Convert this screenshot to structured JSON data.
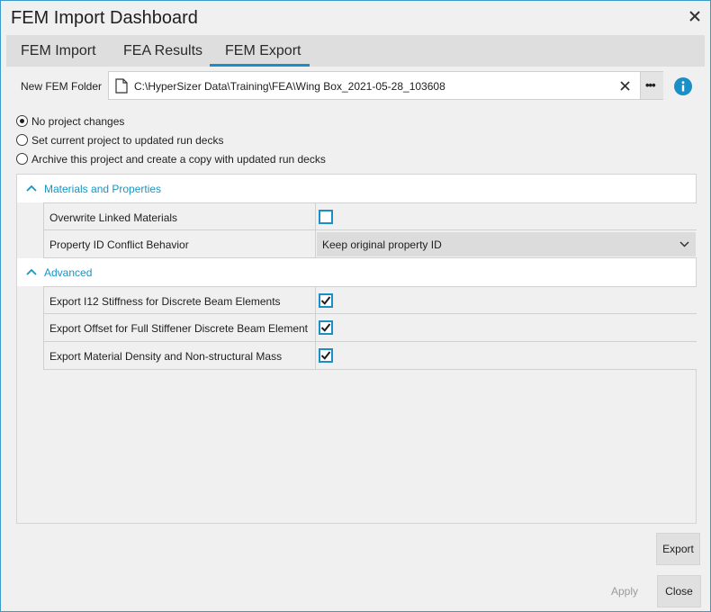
{
  "window": {
    "title": "FEM Import Dashboard",
    "accent_color": "#1a8ec7",
    "close_icon": "close-icon"
  },
  "tabs": [
    {
      "label": "FEM Import",
      "selected": false
    },
    {
      "label": "FEA Results",
      "selected": false
    },
    {
      "label": "FEM Export",
      "selected": true
    }
  ],
  "folder": {
    "label": "New FEM Folder",
    "path": "C:\\HyperSizer Data\\Training\\FEA\\Wing Box_2021-05-28_103608",
    "browse_label": "•••"
  },
  "options": [
    {
      "label": "No project changes",
      "selected": true
    },
    {
      "label": "Set current project to updated run decks",
      "selected": false
    },
    {
      "label": "Archive this project and create a copy with updated run decks",
      "selected": false
    }
  ],
  "sections": [
    {
      "title": "Materials and Properties",
      "expanded": true,
      "rows": [
        {
          "name": "Overwrite Linked Materials",
          "type": "checkbox",
          "checked": false
        },
        {
          "name": "Property ID Conflict Behavior",
          "type": "dropdown",
          "value": "Keep original property ID"
        }
      ]
    },
    {
      "title": "Advanced",
      "expanded": true,
      "rows": [
        {
          "name": "Export I12 Stiffness for Discrete Beam Elements",
          "type": "checkbox",
          "checked": true
        },
        {
          "name": "Export Offset for Full Stiffener Discrete Beam Element",
          "type": "checkbox",
          "checked": true
        },
        {
          "name": "Export Material Density and Non-structural Mass",
          "type": "checkbox",
          "checked": true
        }
      ]
    }
  ],
  "buttons": {
    "export": "Export",
    "apply": "Apply",
    "close": "Close"
  }
}
